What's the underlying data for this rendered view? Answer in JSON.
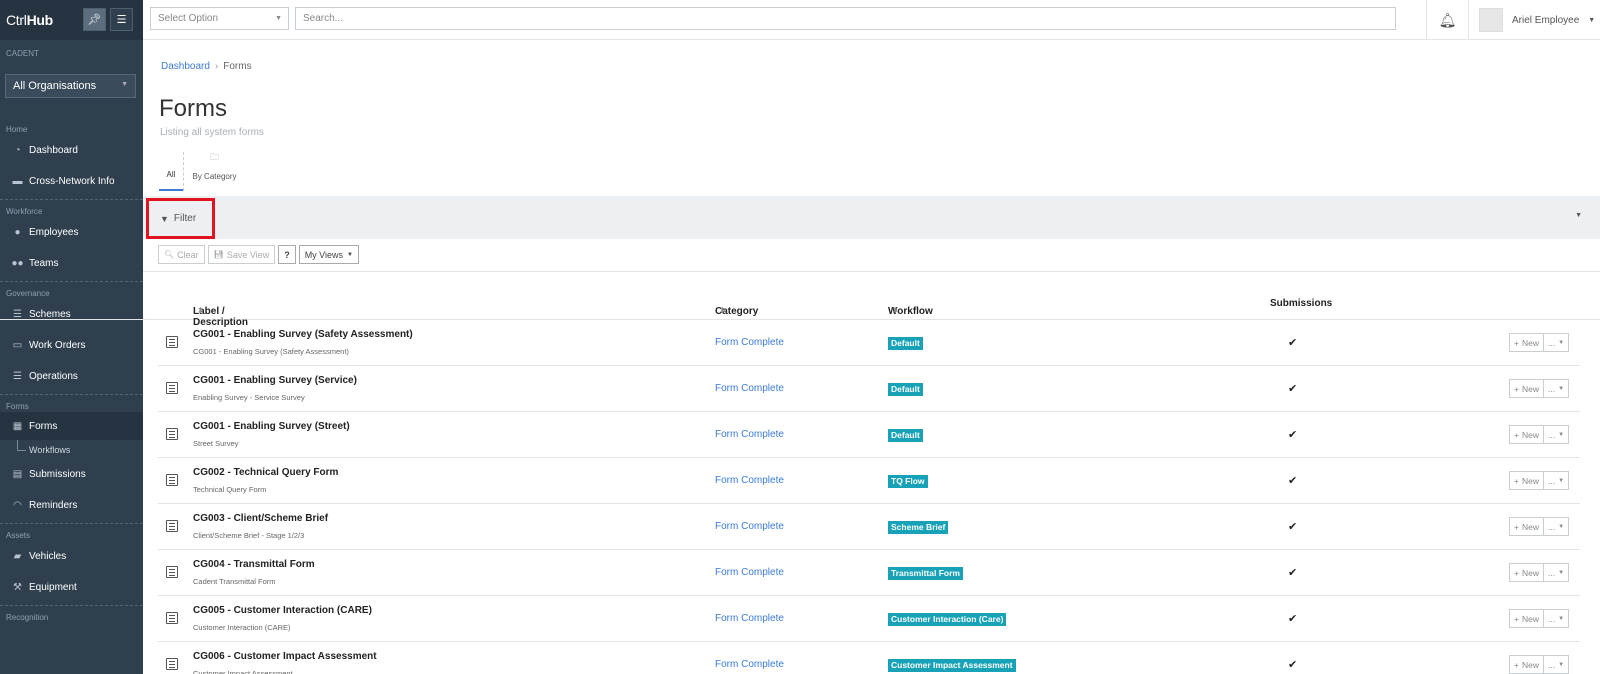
{
  "brand": {
    "light": "Ctrl",
    "bold": "Hub"
  },
  "sidebar": {
    "org_label": "CADENT",
    "org_select": "All Organisations",
    "groups": [
      {
        "head": "Home",
        "items": [
          {
            "label": "Dashboard",
            "icon": "dashboard-icon"
          },
          {
            "label": "Cross-Network Info",
            "icon": "folder-icon"
          }
        ]
      },
      {
        "head": "Workforce",
        "items": [
          {
            "label": "Employees",
            "icon": "user-icon"
          },
          {
            "label": "Teams",
            "icon": "users-icon"
          }
        ]
      },
      {
        "head": "Governance",
        "items": [
          {
            "label": "Schemes",
            "icon": "list-icon"
          },
          {
            "label": "Work Orders",
            "icon": "folder-open-icon"
          },
          {
            "label": "Operations",
            "icon": "list-icon"
          }
        ]
      },
      {
        "head": "Forms",
        "items": [
          {
            "label": "Forms",
            "icon": "form-icon"
          },
          {
            "label": "Workflows",
            "icon": "branch-icon"
          },
          {
            "label": "Submissions",
            "icon": "file-icon"
          },
          {
            "label": "Reminders",
            "icon": "bell-icon"
          }
        ]
      },
      {
        "head": "Assets",
        "items": [
          {
            "label": "Vehicles",
            "icon": "truck-icon"
          },
          {
            "label": "Equipment",
            "icon": "wrench-icon"
          }
        ]
      },
      {
        "head": "Recognition",
        "items": []
      }
    ]
  },
  "topbar": {
    "select_option": "Select Option",
    "search_placeholder": "Search...",
    "user_name": "Ariel Employee"
  },
  "breadcrumb": {
    "home": "Dashboard",
    "current": "Forms"
  },
  "page": {
    "title": "Forms",
    "subtitle": "Listing all system forms"
  },
  "tabs": {
    "all": "All",
    "by_category": "By Category"
  },
  "filter": {
    "label": "Filter"
  },
  "toolbar": {
    "clear": "Clear",
    "save_view": "Save View",
    "help": "?",
    "my_views": "My Views"
  },
  "table": {
    "headers": {
      "label": "Label / Description",
      "category": "Category",
      "workflow": "Workflow",
      "submissions": "Submissions"
    },
    "new_label": "New",
    "more_label": "...",
    "rows": [
      {
        "label": "CG001 - Enabling Survey (Safety Assessment)",
        "desc": "CG001 - Enabling Survey (Safety Assessment)",
        "category": "Form Complete",
        "workflow": "Default"
      },
      {
        "label": "CG001 - Enabling Survey (Service)",
        "desc": "Enabling Survey - Service Survey",
        "category": "Form Complete",
        "workflow": "Default"
      },
      {
        "label": "CG001 - Enabling Survey (Street)",
        "desc": "Street Survey",
        "category": "Form Complete",
        "workflow": "Default"
      },
      {
        "label": "CG002 - Technical Query Form",
        "desc": "Technical Query Form",
        "category": "Form Complete",
        "workflow": "TQ Flow"
      },
      {
        "label": "CG003 - Client/Scheme Brief",
        "desc": "Client/Scheme Brief - Stage 1/2/3",
        "category": "Form Complete",
        "workflow": "Scheme Brief"
      },
      {
        "label": "CG004 - Transmittal Form",
        "desc": "Cadent Transmittal Form",
        "category": "Form Complete",
        "workflow": "Transmittal Form"
      },
      {
        "label": "CG005 - Customer Interaction (CARE)",
        "desc": "Customer Interaction (CARE)",
        "category": "Form Complete",
        "workflow": "Customer Interaction (Care)"
      },
      {
        "label": "CG006 - Customer Impact Assessment",
        "desc": "Customer Impact Assessment",
        "category": "Form Complete",
        "workflow": "Customer Impact Assessment"
      }
    ]
  }
}
